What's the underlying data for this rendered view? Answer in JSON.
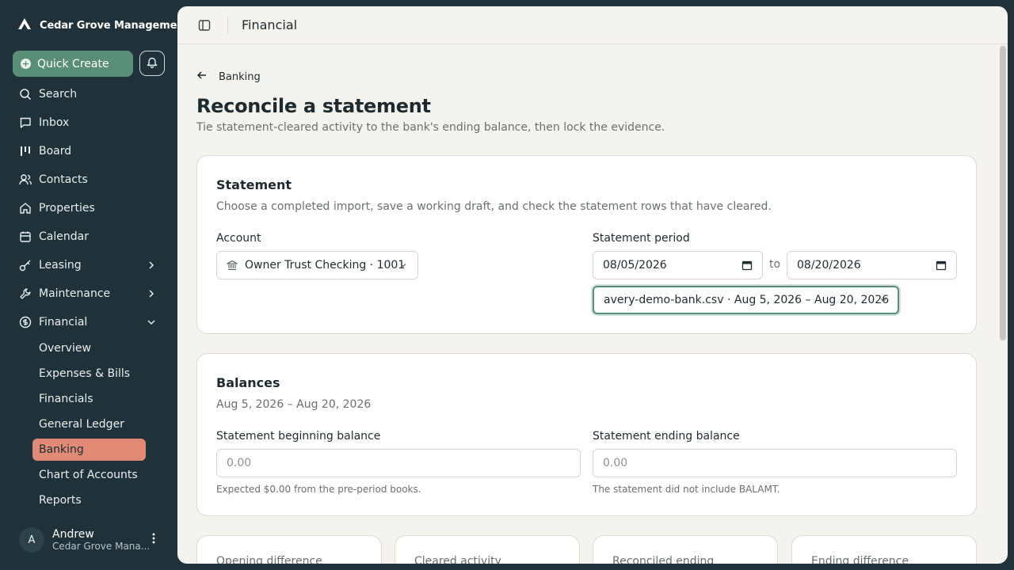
{
  "sidebar": {
    "org_name": "Cedar Grove Manageme...",
    "quick_create": "Quick Create",
    "nav": [
      {
        "label": "Search",
        "icon": "search-icon"
      },
      {
        "label": "Inbox",
        "icon": "inbox-icon"
      },
      {
        "label": "Board",
        "icon": "board-icon"
      },
      {
        "label": "Contacts",
        "icon": "contacts-icon"
      },
      {
        "label": "Properties",
        "icon": "home-icon"
      },
      {
        "label": "Calendar",
        "icon": "calendar-icon"
      },
      {
        "label": "Leasing",
        "icon": "key-icon"
      },
      {
        "label": "Maintenance",
        "icon": "wrench-icon"
      },
      {
        "label": "Financial",
        "icon": "dollar-icon"
      }
    ],
    "financial_sub": [
      "Overview",
      "Expenses & Bills",
      "Financials",
      "General Ledger",
      "Banking",
      "Chart of Accounts",
      "Reports"
    ],
    "active_sub": "Banking",
    "user": {
      "initial": "A",
      "name": "Andrew",
      "org": "Cedar Grove Mana..."
    }
  },
  "topbar": {
    "title": "Financial"
  },
  "breadcrumb": {
    "back_label": "Banking"
  },
  "page": {
    "title": "Reconcile a statement",
    "subtitle": "Tie statement-cleared activity to the bank's ending balance, then lock the evidence."
  },
  "statement": {
    "title": "Statement",
    "subtitle": "Choose a completed import, save a working draft, and check the statement rows that have cleared.",
    "account_label": "Account",
    "account_value": "Owner Trust Checking · 1001",
    "period_label": "Statement period",
    "start_date": "08/05/2026",
    "to_label": "to",
    "end_date": "08/20/2026",
    "import_value": "avery-demo-bank.csv · Aug 5, 2026 – Aug 20, 2026"
  },
  "balances": {
    "title": "Balances",
    "subtitle": "Aug 5, 2026 – Aug 20, 2026",
    "beginning_label": "Statement beginning balance",
    "beginning_placeholder": "0.00",
    "beginning_hint": "Expected $0.00 from the pre-period books.",
    "ending_label": "Statement ending balance",
    "ending_placeholder": "0.00",
    "ending_hint": "The statement did not include BALAMT."
  },
  "summary_cards": [
    "Opening difference",
    "Cleared activity",
    "Reconciled ending",
    "Ending difference"
  ],
  "colors": {
    "accent": "#5a8d78",
    "active_nav": "#e08a78",
    "sidebar_bg": "#1f3239"
  }
}
